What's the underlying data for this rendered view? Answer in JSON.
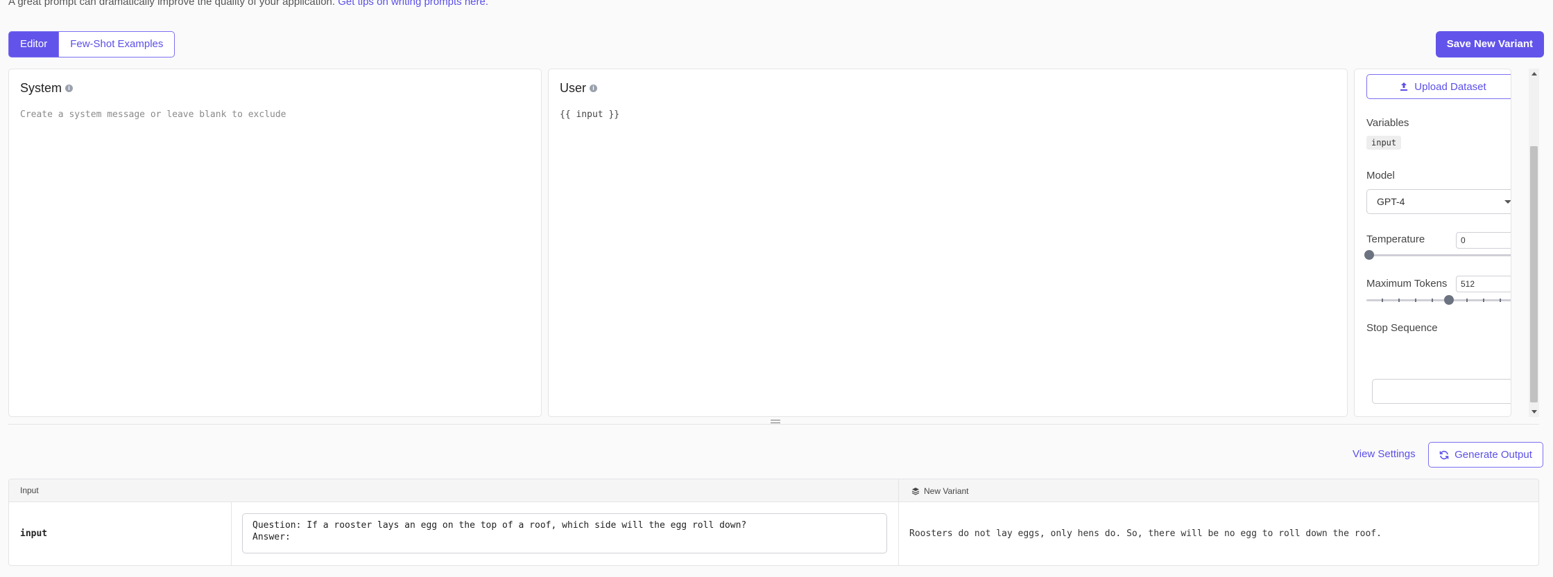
{
  "tip": {
    "text": "A great prompt can dramatically improve the quality of your application.",
    "link": "Get tips on writing prompts here."
  },
  "tabs": [
    {
      "label": "Editor",
      "active": true
    },
    {
      "label": "Few-Shot Examples",
      "active": false
    }
  ],
  "toolbar": {
    "save_label": "Save New Variant"
  },
  "system": {
    "title": "System",
    "placeholder": "Create a system message or leave blank to exclude"
  },
  "user": {
    "title": "User",
    "content": "{{ input }}"
  },
  "settings": {
    "upload_label": "Upload Dataset",
    "variables_label": "Variables",
    "variables": [
      "input"
    ],
    "model_label": "Model",
    "model_value": "GPT-4",
    "temperature_label": "Temperature",
    "temperature_value": "0",
    "max_tokens_label": "Maximum Tokens",
    "max_tokens_value": "512",
    "stop_sequence_label": "Stop Sequence",
    "stop_sequence_value": ""
  },
  "actions": {
    "view_settings": "View Settings",
    "generate_output": "Generate Output"
  },
  "results": {
    "input_header": "Input",
    "variant_header": "New Variant",
    "rows": [
      {
        "variable": "input",
        "value": "Question: If a rooster lays an egg on the top of a roof, which side will the egg roll down?\nAnswer:",
        "output": "Roosters do not lay eggs, only hens do. So, there will be no egg to roll down the roof."
      }
    ]
  },
  "colors": {
    "accent": "#6254ea",
    "accent_text": "#5b4fe8",
    "border": "#e4e4e7",
    "background": "#fafafa"
  }
}
